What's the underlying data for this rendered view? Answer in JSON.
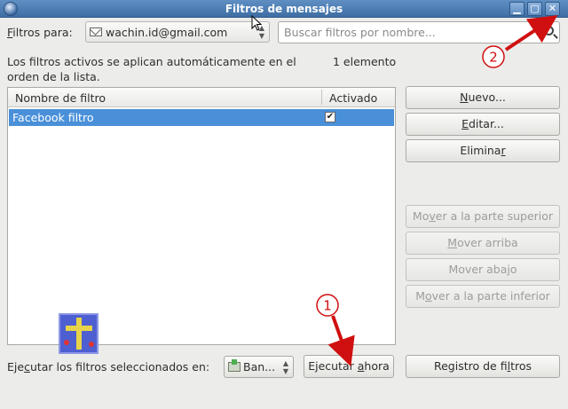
{
  "window": {
    "title": "Filtros de mensajes"
  },
  "filters_for": {
    "label_first": "F",
    "label_rest": "iltros para:",
    "account": "wachin.id@gmail.com"
  },
  "search": {
    "placeholder": "Buscar filtros por nombre..."
  },
  "info": {
    "line1": "Los filtros activos se aplican automáticamente en el",
    "line2": "orden de la lista.",
    "count": "1 elemento"
  },
  "list": {
    "col_name": "Nombre de filtro",
    "col_active": "Activado",
    "rows": [
      {
        "name": "Facebook filtro",
        "active": true
      }
    ]
  },
  "buttons": {
    "new": {
      "u": "N",
      "rest": "uevo..."
    },
    "edit": {
      "u": "E",
      "rest": "ditar..."
    },
    "delete": {
      "pre": "Elimina",
      "u": "r",
      "post": ""
    },
    "move_top": {
      "pre": "Mo",
      "u": "v",
      "post": "er a la parte superior"
    },
    "move_up": {
      "u": "M",
      "rest": "over arriba"
    },
    "move_down": {
      "pre": "Mover aba",
      "u": "j",
      "post": "o"
    },
    "move_bottom": {
      "pre": "M",
      "u": "o",
      "post": "ver a la parte inferior"
    },
    "run_now": {
      "pre": "Ejecutar ",
      "u": "a",
      "post": "hora"
    },
    "filter_log": {
      "pre": "Registro de fi",
      "u": "l",
      "post": "tros"
    }
  },
  "footer": {
    "run_label_pre": "Eje",
    "run_label_u": "c",
    "run_label_post": "utar los filtros seleccionados en:",
    "folder": "Ban..."
  },
  "annotations": {
    "badge1": "1",
    "badge2": "2",
    "color": "#d01010"
  }
}
